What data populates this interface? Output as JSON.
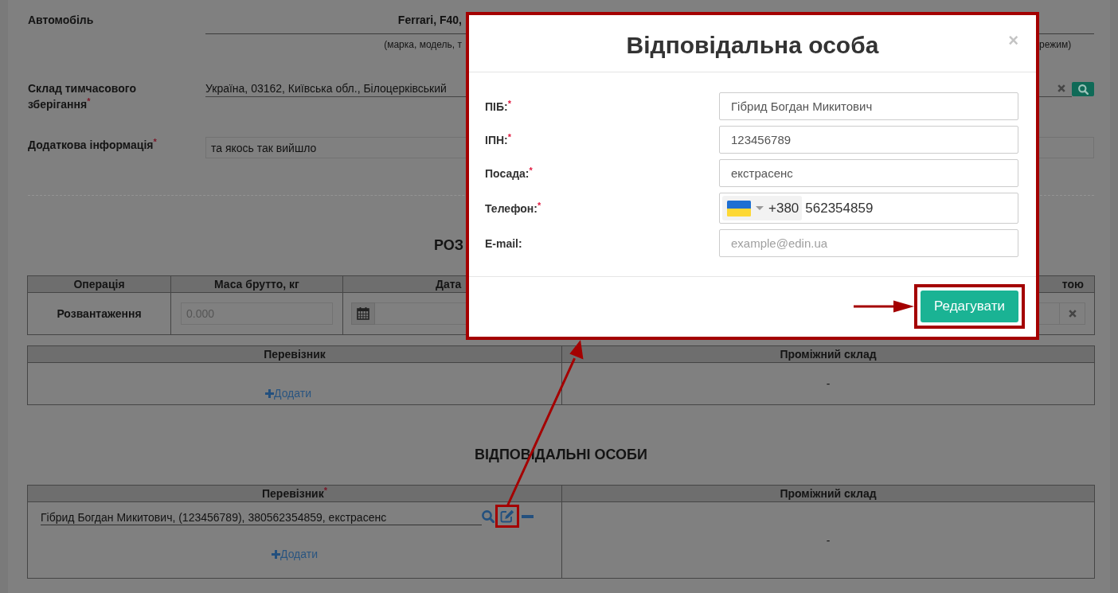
{
  "form": {
    "rows": [
      {
        "kind": "text",
        "label": "Автомобіль",
        "value": "Ferrari, F40,",
        "caption": [
          "(марка, модель, т",
          "режим)"
        ]
      },
      {
        "kind": "lookup",
        "label": "Склад тимчасового зберігання$^{*}$",
        "value": "Україна, 03162, Київська обл., Білоцерківський"
      },
      {
        "kind": "input",
        "label": "Додаткова інформація$^{*}$",
        "value": "та якось так вийшло"
      }
    ]
  },
  "unloading": {
    "heading": "РОЗ",
    "operations_table": {
      "columns": [
        "Операція",
        "Маса брутто, кг",
        "Дата",
        "тою"
      ],
      "rows": [
        {
          "operation": "Розвантаження",
          "mass_placeholder": "0.000"
        }
      ]
    },
    "parties_table": {
      "columns": [
        "Перевізник",
        "Проміжний склад"
      ],
      "add_link": "Додати",
      "warehouse": "-"
    }
  },
  "responsible_persons": {
    "heading": "ВІДПОВІДАЛЬНІ ОСОБИ",
    "table": {
      "columns": [
        "Перевізник$^{*}$",
        "Проміжний склад"
      ],
      "entries": [
        "Гібрид Богдан Микитович, (123456789), 380562354859, екстрасенс"
      ],
      "add_link": "Додати",
      "warehouse": "-"
    }
  },
  "dialog": {
    "title": "Відповідальна особа",
    "close": "×",
    "fields": [
      {
        "kind": "text",
        "label": "ПІБ:$^{*}$",
        "value": "Гібрид Богдан Микитович"
      },
      {
        "kind": "text",
        "label": "ІПН:$^{*}$",
        "value": "123456789"
      },
      {
        "kind": "text",
        "label": "Посада:$^{*}$",
        "value": "екстрасенс"
      },
      {
        "kind": "phone",
        "label": "Телефон:$^{*}$",
        "dial_code": "+380",
        "value": "562354859"
      },
      {
        "kind": "text",
        "label": "E-mail:",
        "placeholder": "example@edin.ua"
      }
    ],
    "buttons": [
      "Редагувати"
    ]
  }
}
